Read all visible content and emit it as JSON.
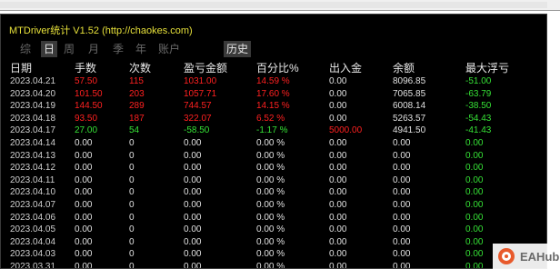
{
  "title": "MTDriver统计 V1.52  (http://chaokes.com)",
  "tabs": [
    "综",
    "日",
    "周",
    "月",
    "季",
    "年",
    "账户",
    "历史"
  ],
  "selected_tab": "日",
  "columns": [
    "日期",
    "手数",
    "次数",
    "盈亏金额",
    "百分比%",
    "出入金",
    "余额",
    "最大浮亏"
  ],
  "rows": [
    {
      "date": "2023.04.21",
      "lots": "57.50",
      "count": "115",
      "pnl": "1031.00",
      "pct": "14.59 %",
      "deposit": "0.00",
      "balance": "8096.85",
      "drawdown": "-51.00",
      "color": "red"
    },
    {
      "date": "2023.04.20",
      "lots": "101.50",
      "count": "203",
      "pnl": "1057.71",
      "pct": "17.60 %",
      "deposit": "0.00",
      "balance": "7065.85",
      "drawdown": "-63.79",
      "color": "red"
    },
    {
      "date": "2023.04.19",
      "lots": "144.50",
      "count": "289",
      "pnl": "744.57",
      "pct": "14.15 %",
      "deposit": "0.00",
      "balance": "6008.14",
      "drawdown": "-38.50",
      "color": "red"
    },
    {
      "date": "2023.04.18",
      "lots": "93.50",
      "count": "187",
      "pnl": "322.07",
      "pct": "6.52 %",
      "deposit": "0.00",
      "balance": "5263.57",
      "drawdown": "-54.43",
      "color": "red"
    },
    {
      "date": "2023.04.17",
      "lots": "27.00",
      "count": "54",
      "pnl": "-58.50",
      "pct": "-1.17 %",
      "deposit": "5000.00",
      "balance": "4941.50",
      "drawdown": "-41.43",
      "color": "green"
    },
    {
      "date": "2023.04.14",
      "lots": "0.00",
      "count": "0",
      "pnl": "0.00",
      "pct": "0.00 %",
      "deposit": "0.00",
      "balance": "0.00",
      "drawdown": "0.00",
      "color": "white"
    },
    {
      "date": "2023.04.13",
      "lots": "0.00",
      "count": "0",
      "pnl": "0.00",
      "pct": "0.00 %",
      "deposit": "0.00",
      "balance": "0.00",
      "drawdown": "0.00",
      "color": "white"
    },
    {
      "date": "2023.04.12",
      "lots": "0.00",
      "count": "0",
      "pnl": "0.00",
      "pct": "0.00 %",
      "deposit": "0.00",
      "balance": "0.00",
      "drawdown": "0.00",
      "color": "white"
    },
    {
      "date": "2023.04.11",
      "lots": "0.00",
      "count": "0",
      "pnl": "0.00",
      "pct": "0.00 %",
      "deposit": "0.00",
      "balance": "0.00",
      "drawdown": "0.00",
      "color": "white"
    },
    {
      "date": "2023.04.10",
      "lots": "0.00",
      "count": "0",
      "pnl": "0.00",
      "pct": "0.00 %",
      "deposit": "0.00",
      "balance": "0.00",
      "drawdown": "0.00",
      "color": "white"
    },
    {
      "date": "2023.04.07",
      "lots": "0.00",
      "count": "0",
      "pnl": "0.00",
      "pct": "0.00 %",
      "deposit": "0.00",
      "balance": "0.00",
      "drawdown": "0.00",
      "color": "white"
    },
    {
      "date": "2023.04.06",
      "lots": "0.00",
      "count": "0",
      "pnl": "0.00",
      "pct": "0.00 %",
      "deposit": "0.00",
      "balance": "0.00",
      "drawdown": "0.00",
      "color": "white"
    },
    {
      "date": "2023.04.05",
      "lots": "0.00",
      "count": "0",
      "pnl": "0.00",
      "pct": "0.00 %",
      "deposit": "0.00",
      "balance": "0.00",
      "drawdown": "0.00",
      "color": "white"
    },
    {
      "date": "2023.04.04",
      "lots": "0.00",
      "count": "0",
      "pnl": "0.00",
      "pct": "0.00 %",
      "deposit": "0.00",
      "balance": "0.00",
      "drawdown": "0.00",
      "color": "white"
    },
    {
      "date": "2023.04.03",
      "lots": "0.00",
      "count": "0",
      "pnl": "0.00",
      "pct": "0.00 %",
      "deposit": "0.00",
      "balance": "0.00",
      "drawdown": "0.00",
      "color": "white"
    },
    {
      "date": "2023.03.31",
      "lots": "0.00",
      "count": "0",
      "pnl": "0.00",
      "pct": "0.00 %",
      "deposit": "0.00",
      "balance": "0.00",
      "drawdown": "0.00",
      "color": "white"
    }
  ],
  "watermark": {
    "icon": "eahub-logo-icon",
    "text": "EAHub"
  },
  "colors": {
    "title": "#e6e03a",
    "profit": "#ff2020",
    "loss": "#35e035",
    "neutral": "#e0e0e0",
    "background": "#000000"
  }
}
